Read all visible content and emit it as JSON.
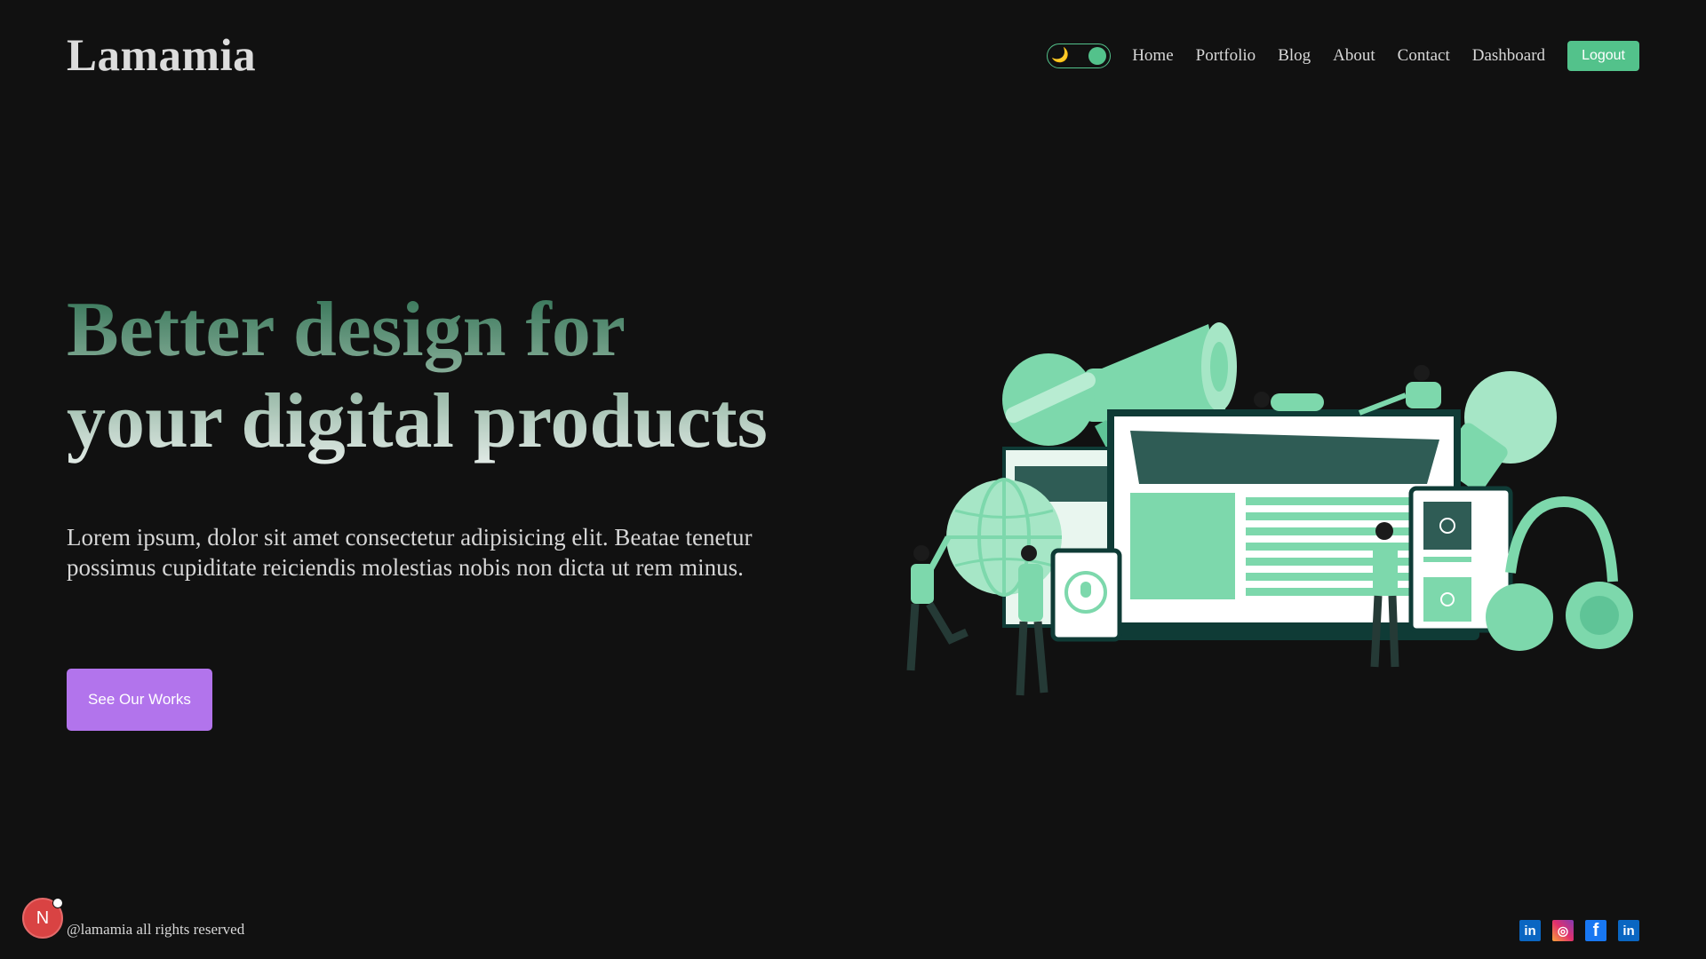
{
  "brand": {
    "logo_text": "Lamamia"
  },
  "nav": {
    "theme_toggle": {
      "icon_left": "🌙",
      "state": "dark"
    },
    "links": [
      {
        "label": "Home"
      },
      {
        "label": "Portfolio"
      },
      {
        "label": "Blog"
      },
      {
        "label": "About"
      },
      {
        "label": "Contact"
      },
      {
        "label": "Dashboard"
      }
    ],
    "logout_label": "Logout"
  },
  "hero": {
    "title_line1": "Better design for",
    "title_line2": "your digital products",
    "description": "Lorem ipsum, dolor sit amet consectetur adipisicing elit. Beatae tenetur possimus cupiditate reiciendis molestias nobis non dicta ut rem minus.",
    "cta_label": "See Our Works"
  },
  "footer": {
    "copyright": "@lamamia all rights reserved",
    "social": [
      {
        "name": "linkedin-icon",
        "glyph": "in"
      },
      {
        "name": "instagram-icon",
        "glyph": "◎"
      },
      {
        "name": "facebook-icon",
        "glyph": "f"
      },
      {
        "name": "linkedin-icon",
        "glyph": "in"
      }
    ]
  },
  "dev_badge": {
    "glyph": "N"
  },
  "colors": {
    "background": "#111111",
    "accent_green": "#53c28b",
    "cta_purple": "#b274ec",
    "illustration_green": "#7dd8ac",
    "illustration_dark": "#0f3b36"
  }
}
